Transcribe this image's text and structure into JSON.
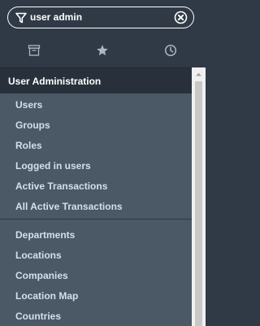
{
  "filter": {
    "value": "user admin",
    "funnel_icon": "filter-icon",
    "clear_icon": "clear-circle-x-icon"
  },
  "tabs": [
    {
      "icon": "archive-box-icon",
      "name": "all"
    },
    {
      "icon": "star-icon",
      "name": "favorites"
    },
    {
      "icon": "clock-icon",
      "name": "history"
    }
  ],
  "section": {
    "title": "User Administration"
  },
  "items_group1": [
    "Users",
    "Groups",
    "Roles",
    "Logged in users",
    "Active Transactions",
    "All Active Transactions"
  ],
  "items_group2": [
    "Departments",
    "Locations",
    "Companies",
    "Location Map",
    "Countries"
  ],
  "colors": {
    "nav_background": "#303a46",
    "header_background": "#28313b",
    "list_background": "#4b5866",
    "item_text": "#cfe0ef",
    "header_text": "#ffffff",
    "scrollbar_track": "#f0f0f0",
    "scrollbar_thumb": "#c8c8c8"
  }
}
